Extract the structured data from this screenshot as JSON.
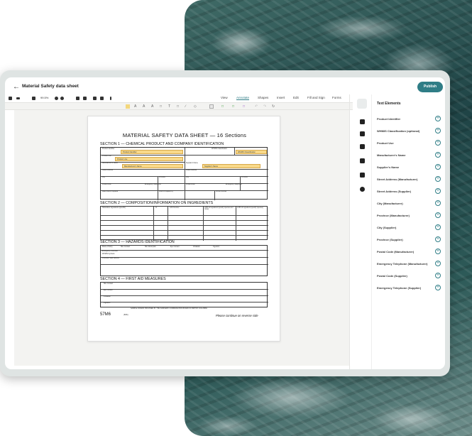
{
  "app": {
    "back_icon": "arrow-left-icon",
    "title": "Material Safety data sheet",
    "publish_label": "Publish"
  },
  "toolbar": {
    "zoom": "99.5%",
    "menus": [
      {
        "label": "View",
        "active": false
      },
      {
        "label": "Annotate",
        "active": true
      },
      {
        "label": "Shapes",
        "active": false
      },
      {
        "label": "Insert",
        "active": false
      },
      {
        "label": "Edit",
        "active": false
      },
      {
        "label": "Fill and Sign",
        "active": false
      },
      {
        "label": "Forms",
        "active": false
      }
    ]
  },
  "document": {
    "title": "MATERIAL SAFETY DATA SHEET — 16 Sections",
    "section1": {
      "title": "SECTION 1 — CHEMICAL PRODUCT AND COMPANY IDENTIFICATION",
      "labels": {
        "product_identifier": "Product Identifier",
        "whmis": "WHMIS Classification",
        "product_use": "Product Use",
        "manufacturer": "Manufacturer's Name",
        "supplier": "Supplier's Name",
        "street_m": "Street Address",
        "street_s": "Street Address",
        "city_m": "City",
        "province_m": "Province",
        "city_s": "City",
        "province_s": "Province",
        "postal_m": "Postal Code",
        "emergency_m": "Emergency Telephone",
        "postal_s": "Postal Code",
        "emergency_s": "Emergency Telephone",
        "prepared_by": "Date MSDS Prepared",
        "msds_prep": "MSDS Prepared by",
        "phone": "Phone Number"
      },
      "fields": {
        "product_identifier": "Product Identifier",
        "whmis": "WHMIS Classification",
        "product_use": "Product Use",
        "manufacturer": "Manufacturer's Name",
        "supplier": "Supplier's Name"
      }
    },
    "section2": {
      "title": "SECTION 2 — COMPOSITION/INFORMATION ON INGREDIENTS",
      "headers": [
        "Hazardous Ingredients (specific)",
        "%",
        "CAS Number",
        "LD50 of Ingredient (specify species and route)",
        "LC50 of Ingredient (specify species)"
      ]
    },
    "section3": {
      "title": "SECTION 3 — HAZARDS IDENTIFICATION",
      "route": "Route of Entry",
      "routes": [
        "Skin Contact",
        "Skin Absorption",
        "Eye Contact",
        "Inhalation",
        "Ingestion"
      ],
      "rows": [
        "Emergency Overview",
        "WHMIS Symbols",
        "Potential Health Effects"
      ]
    },
    "section4": {
      "title": "SECTION 4 — FIRST AID MEASURES",
      "rows": [
        "Skin Contact",
        "Eye Contact",
        "Inhalation",
        "Ingestion"
      ]
    },
    "footer": {
      "sample": "SAMPLE FORMAT PROVIDED BY THE WORKERS' COMPENSATION BOARD OF BRITISH COLUMBIA",
      "code": "57M6",
      "code_small": "(8/96)",
      "note": "Please continue on reverse side"
    }
  },
  "panel": {
    "title": "Text Elements",
    "title_icon": "text-size-icon",
    "side_icons": [
      "text-size-icon",
      "image-icon",
      "checkbox-icon",
      "table-icon",
      "sigma-icon",
      "stamp-icon",
      "gear-icon"
    ],
    "items": [
      "Product Identifier",
      "WHMIS Classification (optional)",
      "Product Use",
      "Manufacturer's Name",
      "Supplier's Name",
      "Street Address (Manufacturer)",
      "Street Address (Supplier)",
      "City (Manufacturer)",
      "Province (Manufacturer)",
      "City (Supplier)",
      "Province (Supplier)",
      "Postal Code (Manufacturer)",
      "Emergency Telephone (Manufacturer)",
      "Postal Code (Supplier)",
      "Emergency Telephone (Supplier)"
    ],
    "add_icon": "plus-circle-icon"
  }
}
